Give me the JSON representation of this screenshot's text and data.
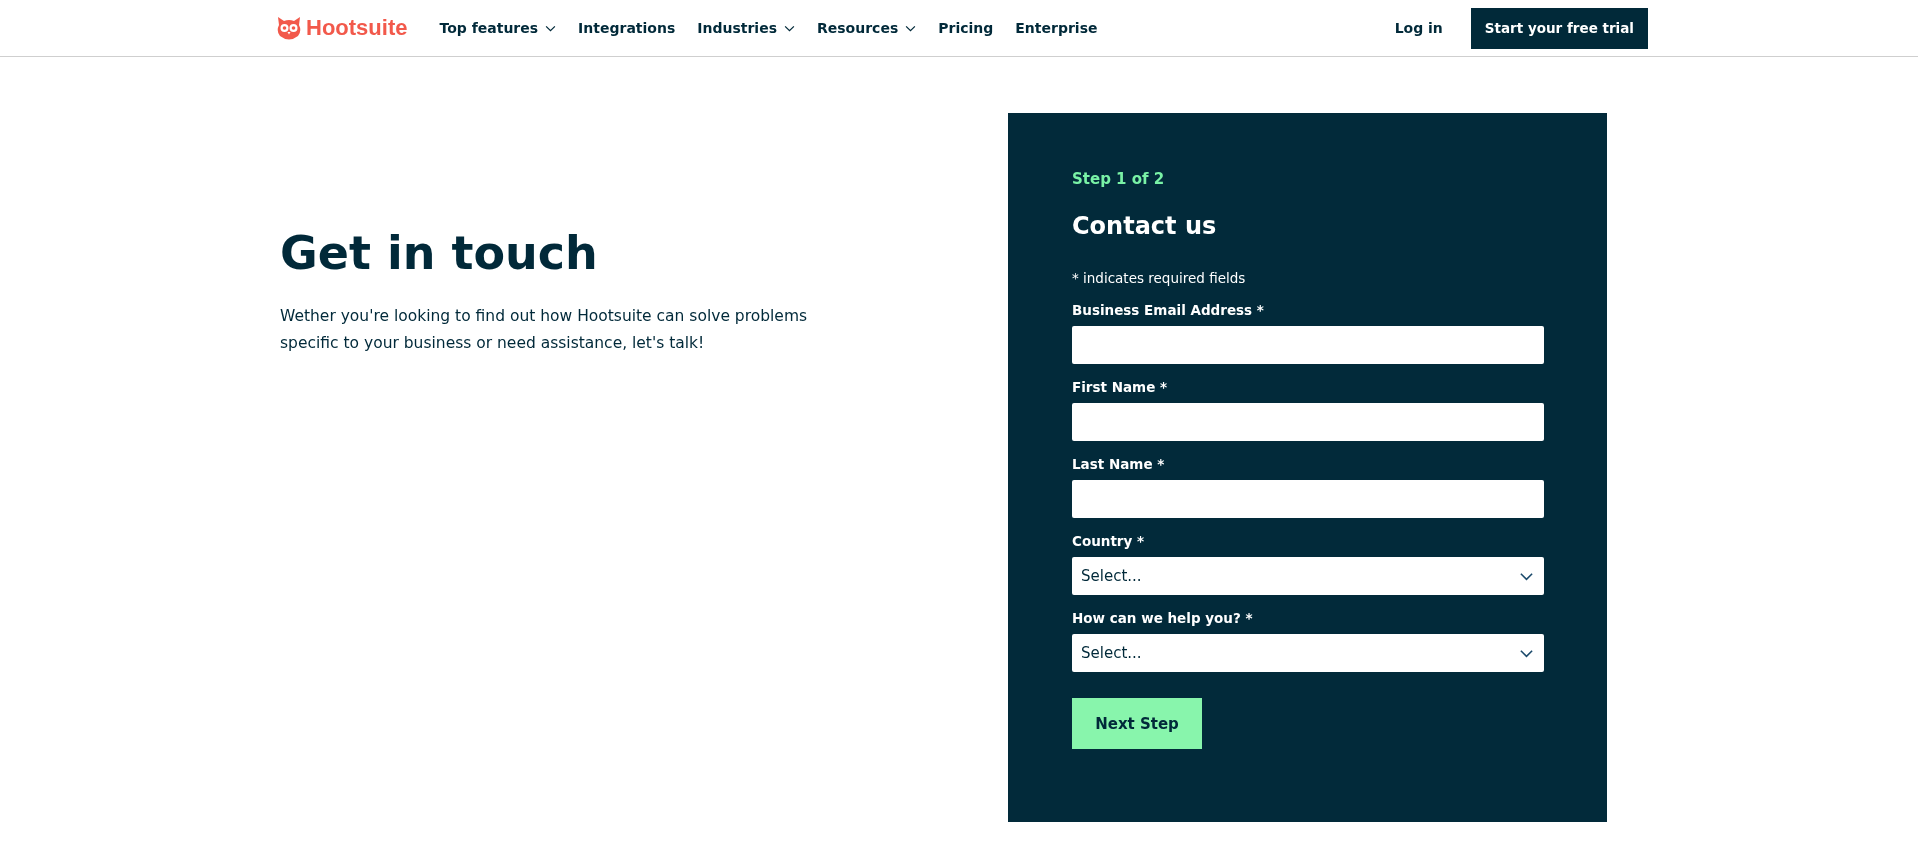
{
  "header": {
    "logo": {
      "text": "Hootsuite"
    },
    "nav": [
      {
        "label": "Top features",
        "kind": "dropdown"
      },
      {
        "label": "Integrations",
        "kind": "link"
      },
      {
        "label": "Industries",
        "kind": "dropdown"
      },
      {
        "label": "Resources",
        "kind": "dropdown"
      },
      {
        "label": "Pricing",
        "kind": "link"
      },
      {
        "label": "Enterprise",
        "kind": "link"
      }
    ],
    "login": "Log in",
    "cta": "Start your free trial"
  },
  "intro": {
    "title": "Get in touch",
    "text": "Wether you're looking to find out how Hootsuite can solve problems specific to your business or need assistance, let's talk!"
  },
  "form": {
    "step": "Step 1 of 2",
    "title": "Contact us",
    "note": "* indicates required fields",
    "fields": [
      {
        "label": "Business Email Address *",
        "kind": "text"
      },
      {
        "label": "First Name *",
        "kind": "text"
      },
      {
        "label": "Last Name *",
        "kind": "text"
      },
      {
        "label": "Country *",
        "kind": "select",
        "value": "Select..."
      },
      {
        "label": "How can we help you? *",
        "kind": "select",
        "value": "Select..."
      }
    ],
    "submit": "Next Step"
  }
}
